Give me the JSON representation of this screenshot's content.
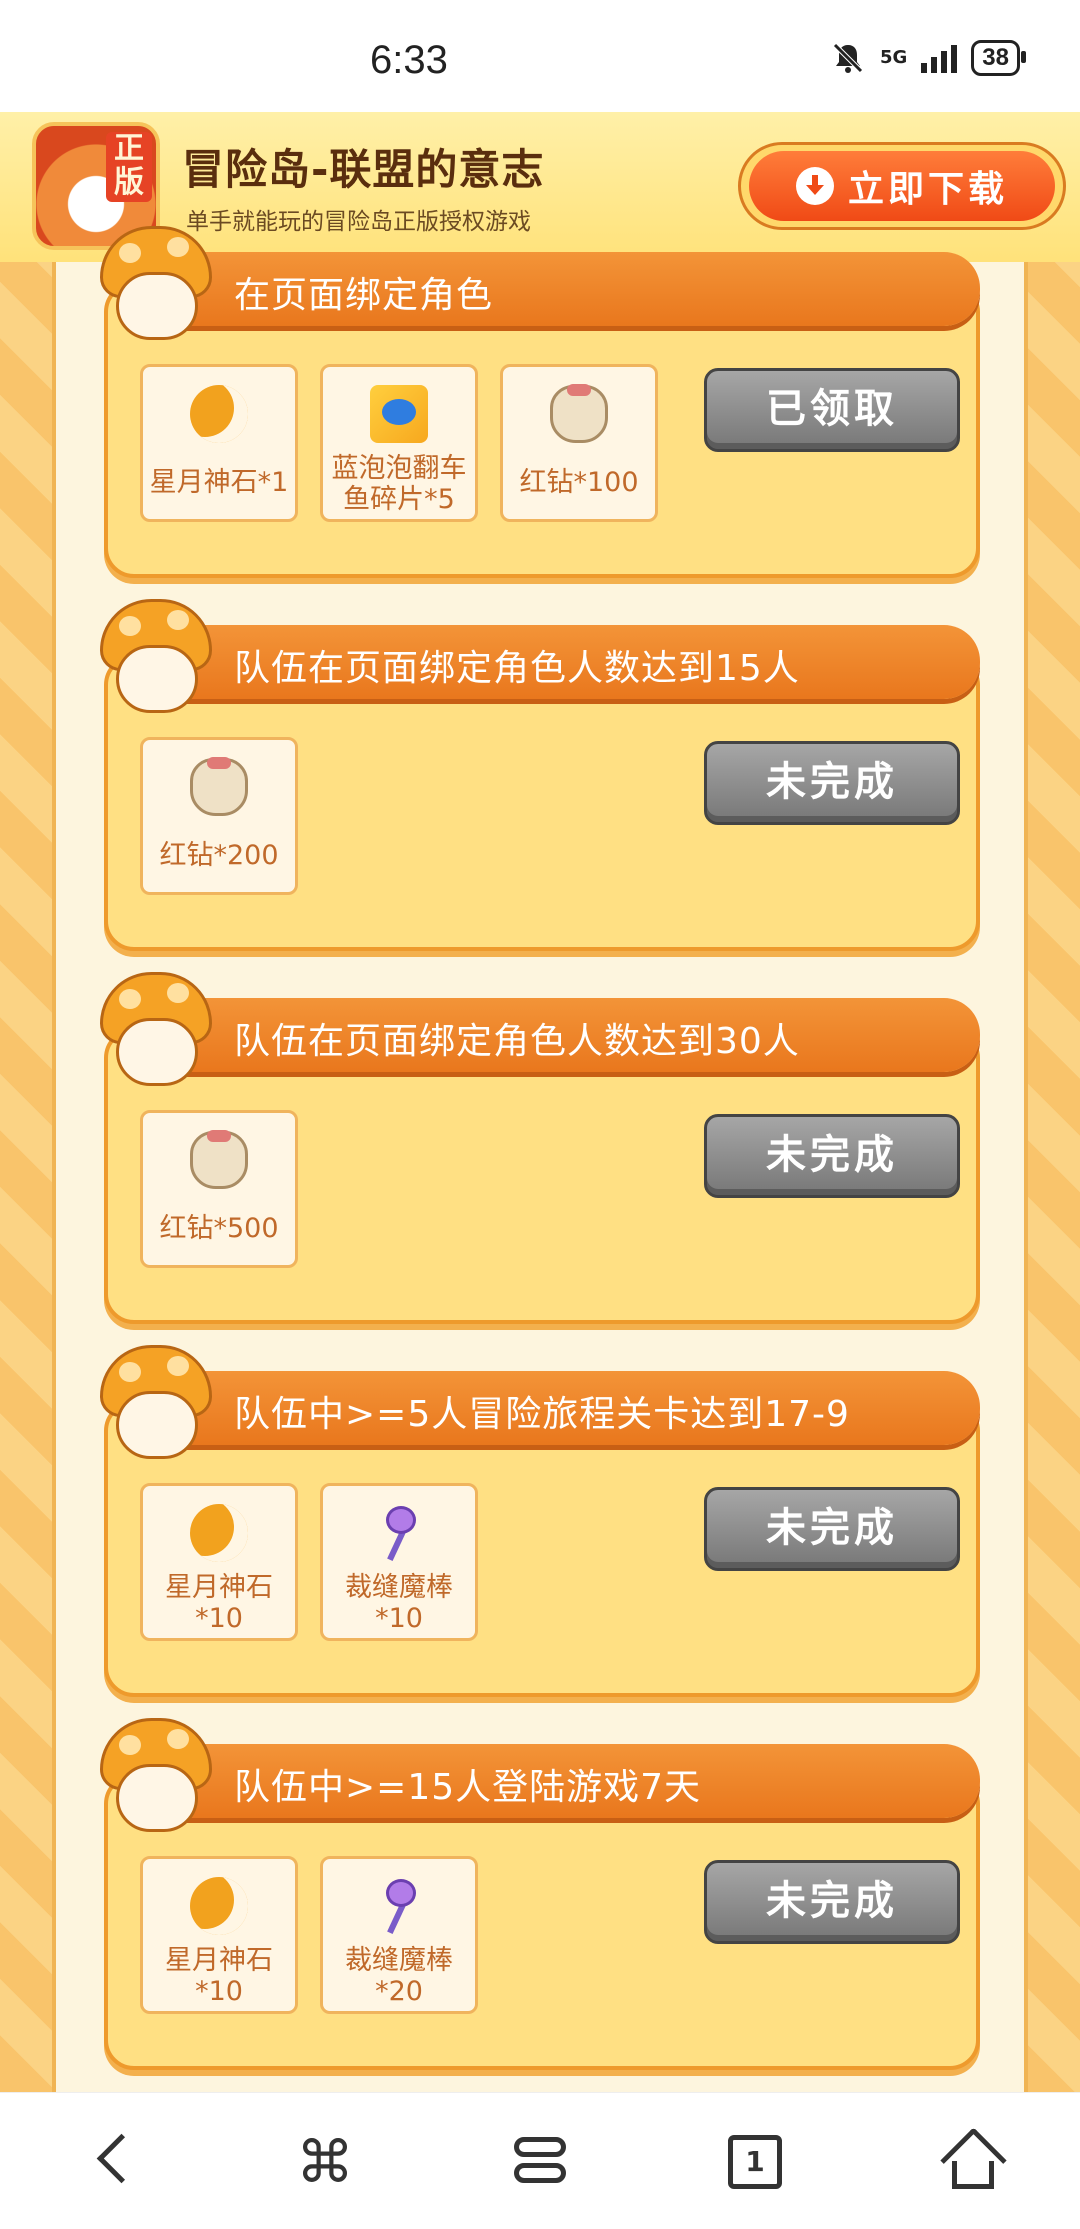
{
  "status_bar": {
    "time": "6:33",
    "network": "5G",
    "battery": "38"
  },
  "banner": {
    "icon_badge": "正版",
    "title": "冒险岛-联盟的意志",
    "subtitle": "单手就能玩的冒险岛正版授权游戏",
    "download_label": "立即下载"
  },
  "tasks": [
    {
      "title": "在页面绑定角色",
      "rewards": [
        {
          "icon": "moon-stone-icon",
          "label": "星月神石*1"
        },
        {
          "icon": "fish-card-icon",
          "label": "蓝泡泡翻车\n鱼碎片*5"
        },
        {
          "icon": "red-diamond-bag-icon",
          "label": "红钻*100"
        }
      ],
      "status": "已领取"
    },
    {
      "title": "队伍在页面绑定角色人数达到15人",
      "rewards": [
        {
          "icon": "red-diamond-bag-icon",
          "label": "红钻*200"
        }
      ],
      "status": "未完成"
    },
    {
      "title": "队伍在页面绑定角色人数达到30人",
      "rewards": [
        {
          "icon": "red-diamond-bag-icon",
          "label": "红钻*500"
        }
      ],
      "status": "未完成"
    },
    {
      "title": "队伍中>=5人冒险旅程关卡达到17-9",
      "rewards": [
        {
          "icon": "moon-stone-icon",
          "label": "星月神石\n*10"
        },
        {
          "icon": "magic-wand-icon",
          "label": "裁缝魔棒\n*10"
        }
      ],
      "status": "未完成"
    },
    {
      "title": "队伍中>=15人登陆游戏7天",
      "rewards": [
        {
          "icon": "moon-stone-icon",
          "label": "星月神石\n*10"
        },
        {
          "icon": "magic-wand-icon",
          "label": "裁缝魔棒\n*20"
        }
      ],
      "status": "未完成"
    }
  ],
  "nav": {
    "tab_count": "1"
  }
}
